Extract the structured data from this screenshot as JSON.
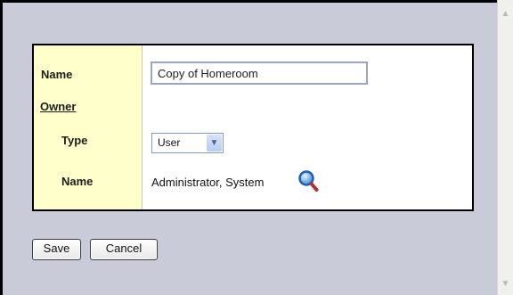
{
  "form": {
    "name_label": "Name",
    "name_value": "Copy of Homeroom",
    "owner_label": "Owner",
    "type_label": "Type",
    "type_value": "User",
    "owner_name_label": "Name",
    "owner_name_value": "Administrator, System"
  },
  "buttons": {
    "save_label": "Save",
    "cancel_label": "Cancel"
  },
  "icons": {
    "lookup": "magnifier-icon",
    "select_arrow": "chevron-down-icon",
    "scroll_up": "scroll-up-arrow-icon",
    "scroll_down": "scroll-down-arrow-icon"
  },
  "colors": {
    "background": "#c9ccd8",
    "label_column": "#ffffcc",
    "panel_border": "#000000",
    "input_border": "#9aa5c7"
  }
}
